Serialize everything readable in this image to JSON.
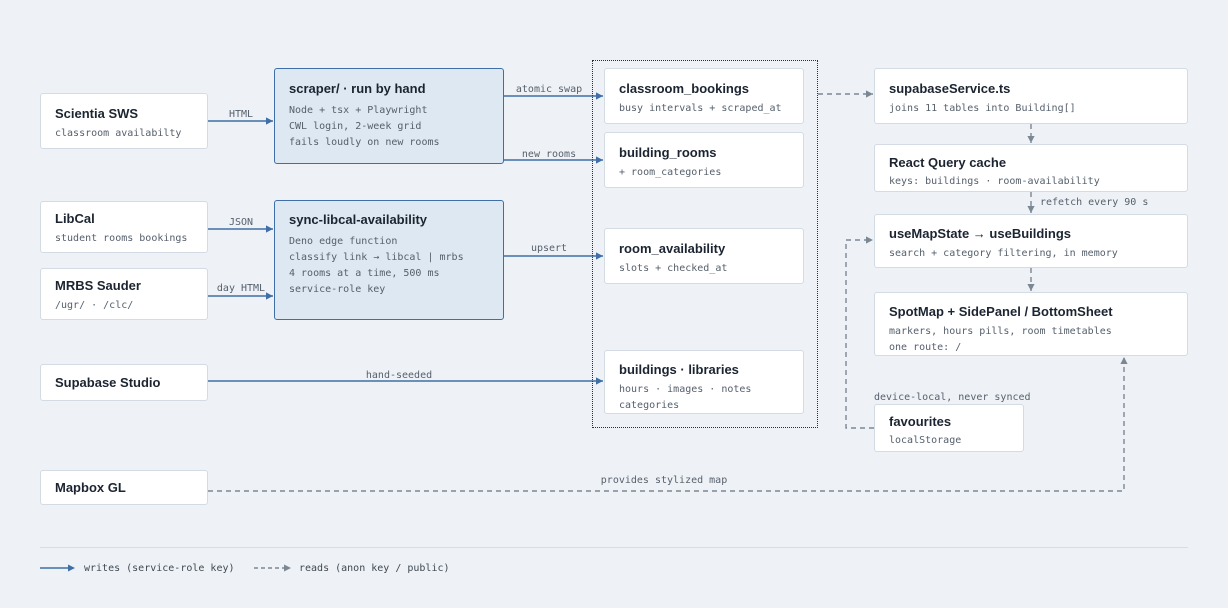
{
  "nodes": {
    "scientia": {
      "title": "Scientia SWS",
      "lines": [
        "classroom availabilty"
      ]
    },
    "libcal": {
      "title": "LibCal",
      "lines": [
        "student rooms bookings"
      ]
    },
    "mrbs": {
      "title": "MRBS Sauder",
      "lines": [
        "/ugr/ · /clc/"
      ]
    },
    "supabase_studio": {
      "title": "Supabase Studio",
      "lines": []
    },
    "mapbox": {
      "title": "Mapbox GL",
      "lines": []
    },
    "scraper": {
      "title": "scraper/ · run by hand",
      "lines": [
        "Node + tsx + Playwright",
        "CWL login, 2-week grid",
        "fails loudly on new rooms"
      ]
    },
    "sync_libcal": {
      "title": "sync-libcal-availability",
      "lines": [
        "Deno edge function",
        "classify link → libcal | mrbs",
        "4 rooms at a time, 500 ms",
        "service-role key"
      ]
    },
    "classroom_bookings": {
      "title": "classroom_bookings",
      "lines": [
        "busy intervals + scraped_at"
      ]
    },
    "building_rooms": {
      "title": "building_rooms",
      "lines": [
        "+ room_categories"
      ]
    },
    "room_availability": {
      "title": "room_availability",
      "lines": [
        "slots + checked_at"
      ]
    },
    "buildings_libraries": {
      "title": "buildings · libraries",
      "lines": [
        "hours · images · notes",
        "categories"
      ]
    },
    "supabase_service": {
      "title": "supabaseService.ts",
      "lines": [
        "joins 11 tables into Building[]"
      ]
    },
    "react_query": {
      "title": "React Query cache",
      "lines": [
        "keys: buildings · room-availability"
      ]
    },
    "use_map_state": {
      "title": "useMapState → useBuildings",
      "lines": [
        "search + category filtering, in memory"
      ]
    },
    "spotmap": {
      "title": "SpotMap + SidePanel / BottomSheet",
      "lines": [
        "markers, hours pills, room timetables",
        "one route: /"
      ]
    },
    "favourites": {
      "title": "favourites",
      "lines": [
        "localStorage"
      ]
    }
  },
  "edge_labels": {
    "html": "HTML",
    "json": "JSON",
    "day_html": "day HTML",
    "atomic_swap": "atomic swap",
    "new_rooms": "new rooms",
    "upsert": "upsert",
    "hand_seeded": "hand-seeded",
    "refetch": "refetch every 90 s",
    "device_local": "device-local, never synced",
    "provides_map": "provides stylized map"
  },
  "legend": {
    "writes": "writes (service-role key)",
    "reads": "reads (anon key / public)"
  },
  "colors": {
    "background": "#eef2f6",
    "write_edge": "#3e6fa6",
    "read_edge": "#7c8794",
    "process_fill": "#dde8f3",
    "node_fill": "#ffffff"
  }
}
